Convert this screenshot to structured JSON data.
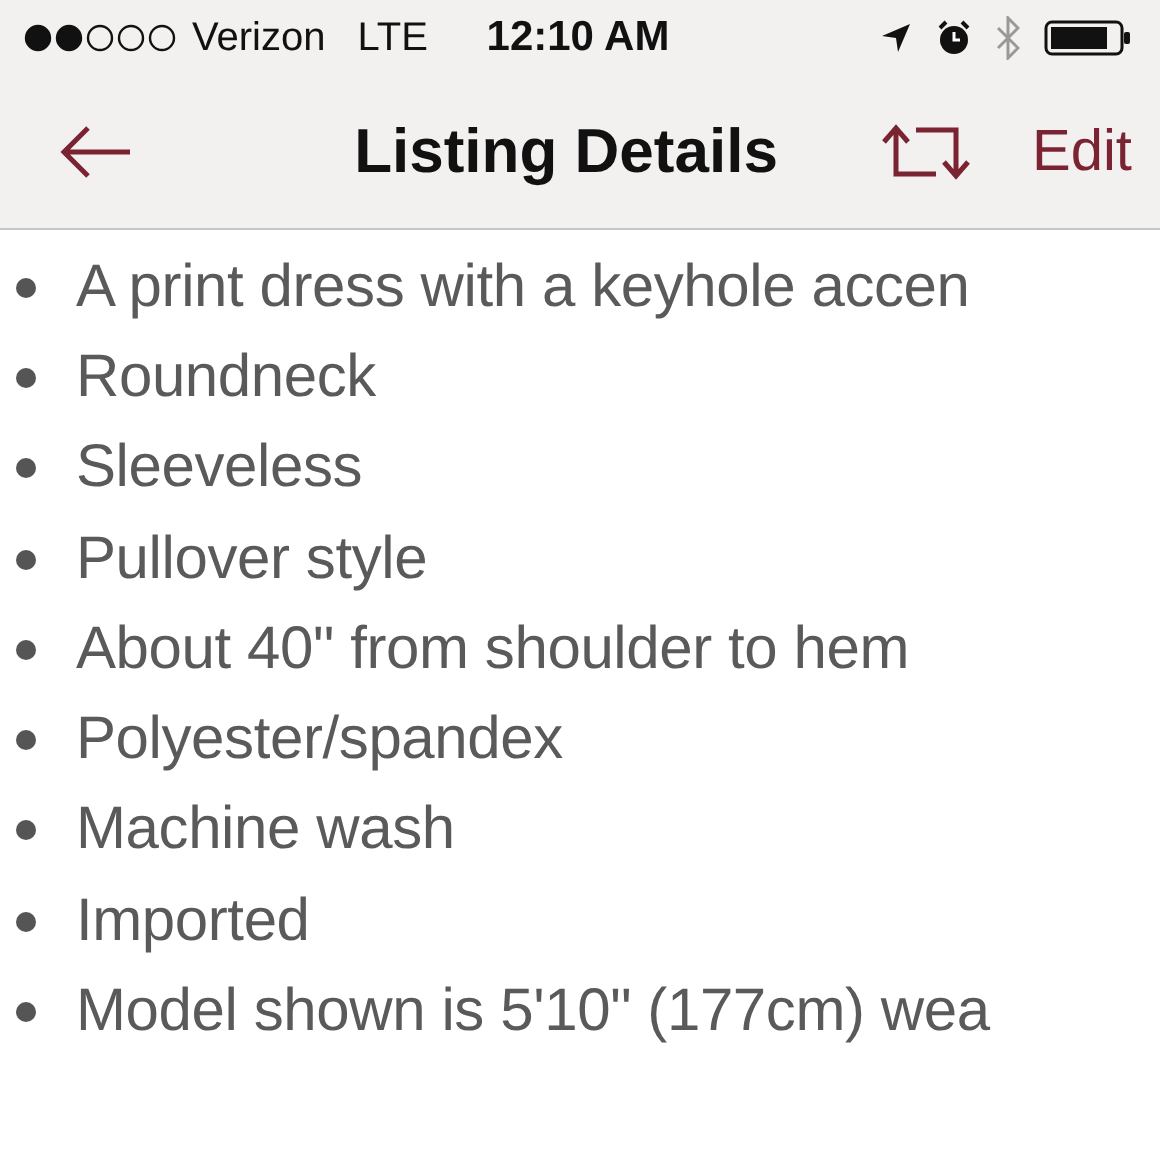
{
  "status_bar": {
    "carrier": "Verizon",
    "network": "LTE",
    "time": "12:10 AM"
  },
  "nav_bar": {
    "title": "Listing Details",
    "edit": "Edit"
  },
  "details": [
    "A print dress with a keyhole accen",
    "Roundneck",
    "Sleeveless",
    "Pullover style",
    "About 40\" from shoulder to hem",
    "Polyester/spandex",
    "Machine wash",
    "Imported",
    "Model shown is 5'10\" (177cm) wea"
  ]
}
